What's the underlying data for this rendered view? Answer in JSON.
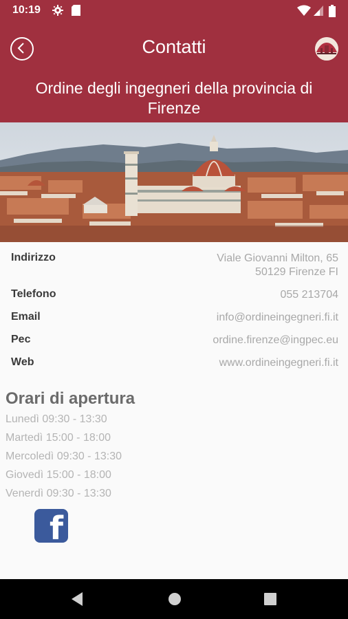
{
  "status_bar": {
    "time": "10:19",
    "icons": [
      "gear-icon",
      "sd-card-icon",
      "wifi-icon",
      "signal-icon",
      "battery-icon"
    ]
  },
  "header": {
    "title": "Contatti",
    "back_icon": "chevron-left-icon",
    "logo_icon": "logo-icon",
    "org_name": "Ordine degli ingegneri della provincia di Firenze",
    "background_color": "#a0303f"
  },
  "contacts": [
    {
      "label": "Indirizzo",
      "value_line1": "Viale Giovanni Milton, 65",
      "value_line2": "50129 Firenze FI"
    },
    {
      "label": "Telefono",
      "value": "055 213704"
    },
    {
      "label": "Email",
      "value": "info@ordineingegneri.fi.it"
    },
    {
      "label": "Pec",
      "value": "ordine.firenze@ingpec.eu"
    },
    {
      "label": "Web",
      "value": "www.ordineingegneri.fi.it"
    }
  ],
  "hours": {
    "title": "Orari di apertura",
    "lines": [
      "Lunedì 09:30 - 13:30",
      "Martedì 15:00 - 18:00",
      "Mercoledì 09:30 - 13:30",
      "Giovedì 15:00 - 18:00",
      "Venerdì 09:30 - 13:30"
    ]
  },
  "social": {
    "facebook_icon": "facebook-icon",
    "facebook_letter": "f",
    "facebook_color": "#3b5a9c"
  },
  "nav_bar": {
    "icons": [
      "back-triangle-icon",
      "home-circle-icon",
      "recents-square-icon"
    ]
  }
}
